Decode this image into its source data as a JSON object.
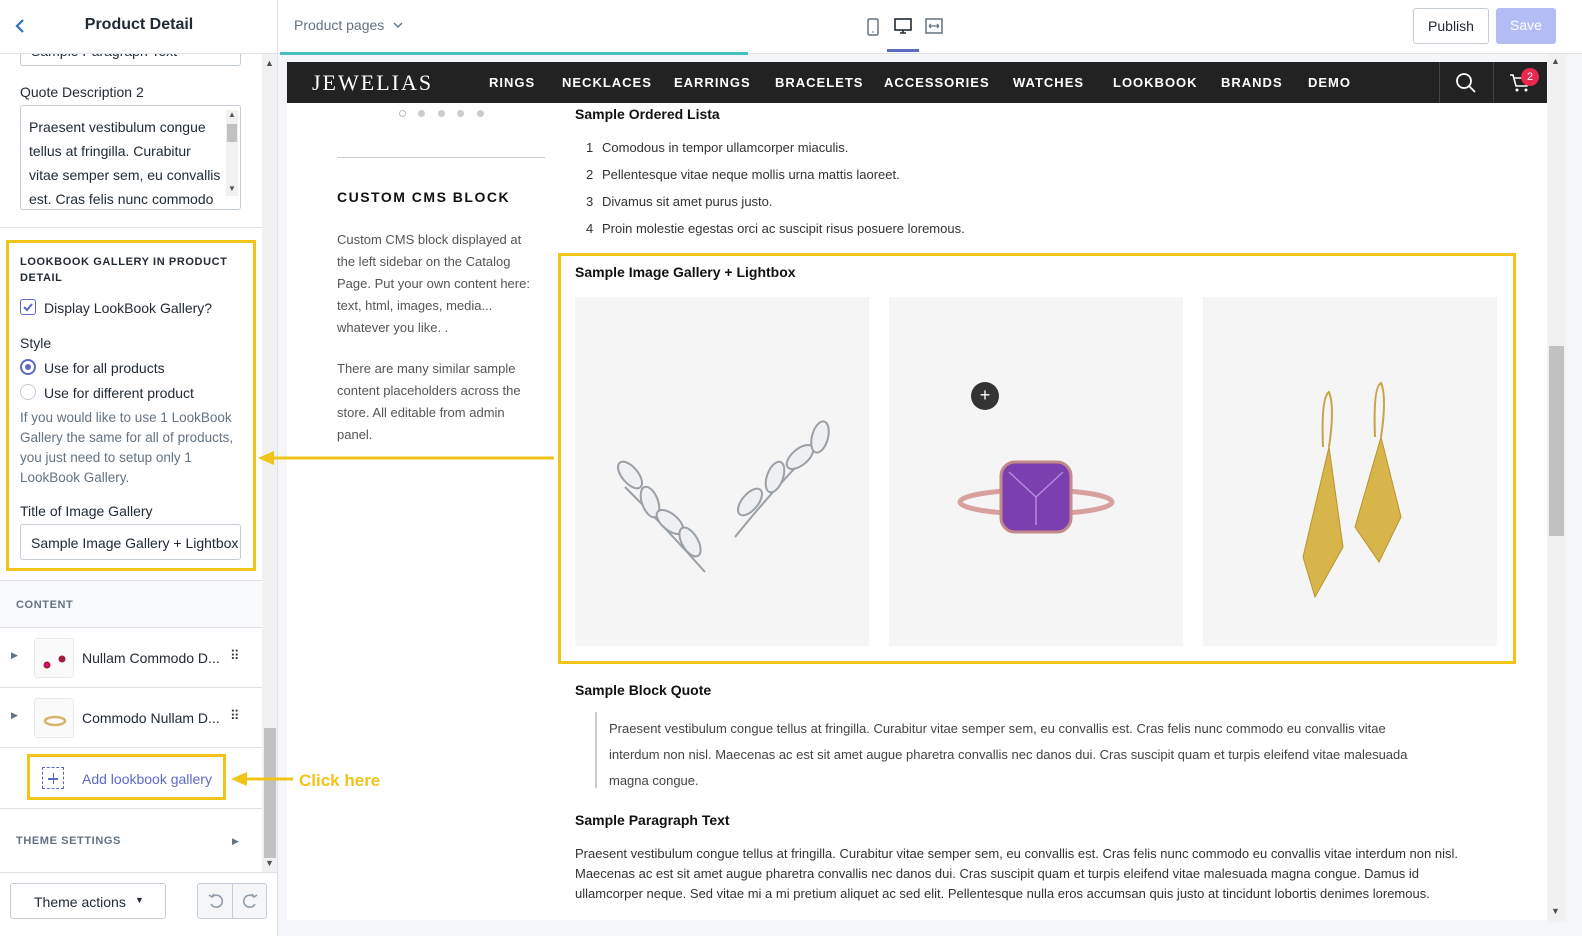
{
  "sidebar": {
    "title": "Product Detail",
    "back_icon": "chevron-left-icon",
    "cut_input_value": "Sample Paragraph Text",
    "quote2_label": "Quote Description 2",
    "quote2_lines": [
      "Praesent vestibulum congue",
      "tellus at fringilla. Curabitur",
      "vitae semper sem, eu convallis",
      "est. Cras felis nunc commodo"
    ],
    "lookbook_heading": "LOOKBOOK GALLERY IN PRODUCT DETAIL",
    "display_checkbox_label": "Display LookBook Gallery?",
    "display_checked": true,
    "style_label": "Style",
    "style_options": [
      {
        "label": "Use for all products",
        "selected": true
      },
      {
        "label": "Use for different product",
        "selected": false
      }
    ],
    "help_lines": [
      "If you would like to use 1 LookBook",
      "Gallery the same for all of products,",
      "you just need to setup only 1",
      "LookBook Gallery."
    ],
    "gallery_title_label": "Title of Image Gallery",
    "gallery_title_value": "Sample Image Gallery + Lightbox",
    "content_label": "CONTENT",
    "content_items": [
      {
        "label": "Nullam Commodo D..."
      },
      {
        "label": "Commodo Nullam D..."
      }
    ],
    "add_gallery_label": "Add lookbook gallery",
    "theme_settings_label": "THEME SETTINGS",
    "theme_actions_label": "Theme actions"
  },
  "annotation": {
    "click_here": "Click here",
    "highlight_color": "#f0c419"
  },
  "topbar": {
    "page_selector": "Product pages",
    "publish_label": "Publish",
    "save_label": "Save",
    "view_icons": [
      "mobile-icon",
      "desktop-icon",
      "fullwidth-icon"
    ]
  },
  "store": {
    "logo": "JEWELIAS",
    "nav": [
      "RINGS",
      "NECKLACES",
      "EARRINGS",
      "BRACELETS",
      "ACCESSORIES",
      "WATCHES",
      "LOOKBOOK",
      "BRANDS",
      "DEMO"
    ],
    "cart_count": "2",
    "cms_title": "CUSTOM CMS BLOCK",
    "cms_p1": [
      "Custom CMS block displayed at",
      "the left sidebar on the Catalog",
      "Page. Put your own content here:",
      "text, html, images, media...",
      "whatever you like. ."
    ],
    "cms_p2": [
      "There are many similar sample",
      "content placeholders across the",
      "store. All editable from admin",
      "panel."
    ],
    "ordered_title": "Sample Ordered Lista",
    "ordered_items": [
      {
        "num": "1",
        "text": "Comodous in tempor ullamcorper miaculis."
      },
      {
        "num": "2",
        "text": "Pellentesque vitae neque mollis urna mattis laoreet."
      },
      {
        "num": "3",
        "text": "Divamus sit amet purus justo."
      },
      {
        "num": "4",
        "text": "Proin molestie egestas orci ac suscipit risus posuere loremous."
      }
    ],
    "gallery_title": "Sample Image Gallery + Lightbox",
    "gallery_images": [
      "silver-leaf-earrings",
      "amethyst-ring",
      "gold-mesh-earrings"
    ],
    "quote_title": "Sample Block Quote",
    "quote_lines": [
      "Praesent vestibulum congue tellus at fringilla. Curabitur vitae semper sem, eu convallis est. Cras felis nunc commodo eu convallis vitae",
      "interdum non nisl. Maecenas ac est sit amet augue pharetra convallis nec danos dui. Cras suscipit quam et turpis eleifend vitae malesuada",
      "magna congue."
    ],
    "para_title": "Sample Paragraph Text",
    "para_lines": [
      "Praesent vestibulum congue tellus at fringilla. Curabitur vitae semper sem, eu convallis est. Cras felis nunc commodo eu convallis vitae interdum non nisl.",
      "Maecenas ac est sit amet augue pharetra convallis nec danos dui. Cras suscipit quam et turpis eleifend vitae malesuada magna congue. Damus id",
      "ullamcorper neque. Sed vitae mi a mi pretium aliquet ac sed elit. Pellentesque nulla eros accumsan quis justo at tincidunt lobortis denimes loremous."
    ]
  }
}
